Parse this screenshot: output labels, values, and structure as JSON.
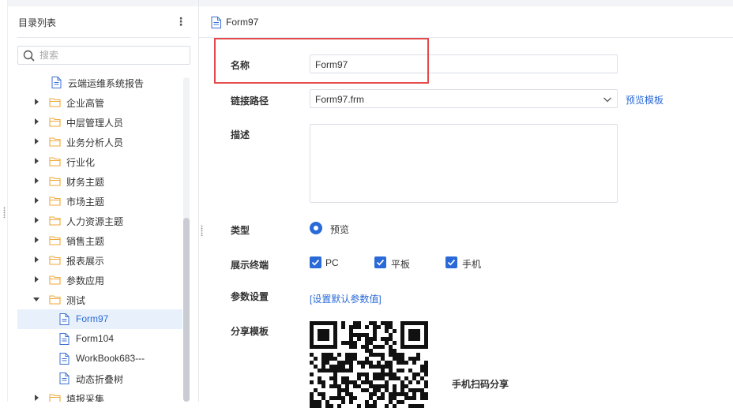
{
  "sidebar": {
    "title": "目录列表",
    "more_icon": "⋮",
    "search": {
      "placeholder": "搜索",
      "value": ""
    },
    "tree": [
      {
        "label": "云端运维系统报告",
        "type": "report",
        "caret": "none",
        "indent": 0,
        "selected": false
      },
      {
        "label": "企业高管",
        "type": "folder",
        "caret": "right",
        "indent": 0,
        "selected": false
      },
      {
        "label": "中层管理人员",
        "type": "folder",
        "caret": "right",
        "indent": 0,
        "selected": false
      },
      {
        "label": "业务分析人员",
        "type": "folder",
        "caret": "right",
        "indent": 0,
        "selected": false
      },
      {
        "label": "行业化",
        "type": "folder",
        "caret": "right",
        "indent": 0,
        "selected": false
      },
      {
        "label": "财务主题",
        "type": "folder",
        "caret": "right",
        "indent": 0,
        "selected": false
      },
      {
        "label": "市场主题",
        "type": "folder",
        "caret": "right",
        "indent": 0,
        "selected": false
      },
      {
        "label": "人力资源主题",
        "type": "folder",
        "caret": "right",
        "indent": 0,
        "selected": false
      },
      {
        "label": "销售主题",
        "type": "folder",
        "caret": "right",
        "indent": 0,
        "selected": false
      },
      {
        "label": "报表展示",
        "type": "folder",
        "caret": "right",
        "indent": 0,
        "selected": false
      },
      {
        "label": "参数应用",
        "type": "folder",
        "caret": "right",
        "indent": 0,
        "selected": false
      },
      {
        "label": "测试",
        "type": "folder",
        "caret": "down",
        "indent": 0,
        "selected": false
      },
      {
        "label": "Form97",
        "type": "report",
        "caret": "none",
        "indent": 1,
        "selected": true
      },
      {
        "label": "Form104",
        "type": "report",
        "caret": "none",
        "indent": 1,
        "selected": false
      },
      {
        "label": "WorkBook683---",
        "type": "report",
        "caret": "none",
        "indent": 1,
        "selected": false
      },
      {
        "label": "动态折叠树",
        "type": "report",
        "caret": "none",
        "indent": 1,
        "selected": false
      },
      {
        "label": "填报采集",
        "type": "folder",
        "caret": "right",
        "indent": 0,
        "selected": false
      }
    ]
  },
  "main": {
    "title": "Form97",
    "name": {
      "label": "名称",
      "value": "Form97"
    },
    "path": {
      "label": "链接路径",
      "value": "Form97.frm",
      "preview_link": "预览模板"
    },
    "description": {
      "label": "描述",
      "value": ""
    },
    "type": {
      "label": "类型",
      "option": "预览",
      "selected": true
    },
    "terminals": {
      "label": "展示终端",
      "options": [
        {
          "label": "PC",
          "checked": true
        },
        {
          "label": "平板",
          "checked": true
        },
        {
          "label": "手机",
          "checked": true
        }
      ]
    },
    "params": {
      "label": "参数设置",
      "link": "[设置默认参数值]"
    },
    "share": {
      "label": "分享模板",
      "caption": "手机扫码分享"
    }
  },
  "colors": {
    "accent": "#2a6ad8",
    "highlight": "#e34a4a",
    "folder": "#f0a83a"
  }
}
